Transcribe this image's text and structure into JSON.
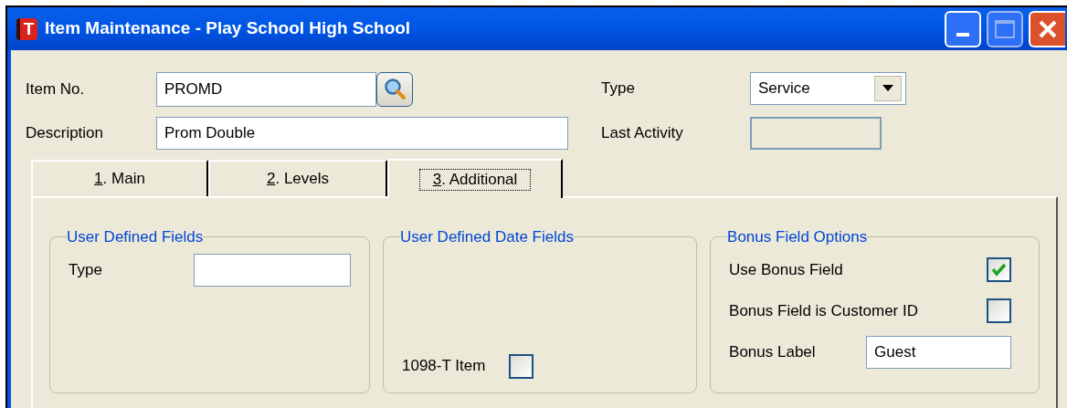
{
  "window": {
    "title": "Item Maintenance - Play School High School",
    "icon_letter": "T"
  },
  "header": {
    "item_no": {
      "label": "Item No.",
      "value": "PROMD"
    },
    "description": {
      "label": "Description",
      "value": "Prom Double"
    },
    "type": {
      "label": "Type",
      "value": "Service"
    },
    "last_activity": {
      "label": "Last Activity",
      "disabled": true
    }
  },
  "tabs": [
    {
      "label": "1. Main",
      "selected": false
    },
    {
      "label": "2. Levels",
      "selected": false
    },
    {
      "label": "3. Additional",
      "selected": true
    }
  ],
  "groups": [
    {
      "title": "User Defined Fields",
      "items": [
        {
          "kind": "text",
          "label": "Type"
        }
      ]
    },
    {
      "title": "User Defined Date Fields",
      "items": [
        {
          "kind": "checkbox",
          "label": "1098-T Item",
          "checked": false
        }
      ]
    },
    {
      "title": "Bonus Field Options",
      "items": [
        {
          "kind": "checkbox",
          "label": "Use Bonus Field",
          "checked": true
        },
        {
          "kind": "checkbox",
          "label": "Bonus Field is Customer ID",
          "checked": false
        },
        {
          "kind": "text",
          "label": "Bonus Label",
          "value": "Guest"
        }
      ]
    }
  ]
}
